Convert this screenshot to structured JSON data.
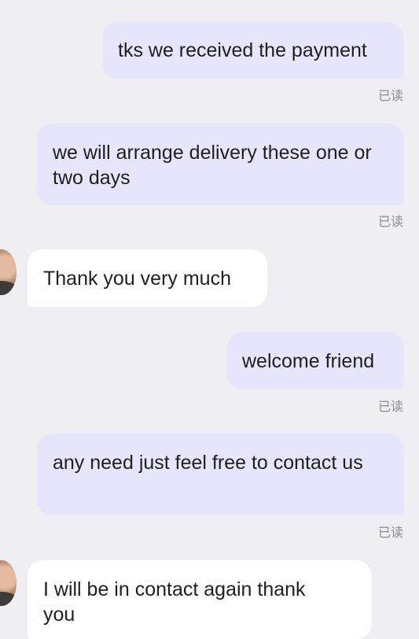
{
  "messages": [
    {
      "direction": "out",
      "text": "tks we received the payment",
      "status": "已读"
    },
    {
      "direction": "out",
      "text": "we will arrange delivery these one or two days",
      "status": "已读"
    },
    {
      "direction": "in",
      "text": "Thank you very much"
    },
    {
      "direction": "out",
      "text": "welcome friend",
      "status": "已读"
    },
    {
      "direction": "out",
      "text": "any need just feel free to contact us",
      "status": "已读"
    },
    {
      "direction": "in",
      "text": "I will be in contact again thank you"
    }
  ],
  "colors": {
    "background": "#eeeef3",
    "outgoing_bubble": "#e5e6fb",
    "incoming_bubble": "#ffffff",
    "text": "#1f1f1f",
    "read_status": "#8b8b92"
  }
}
